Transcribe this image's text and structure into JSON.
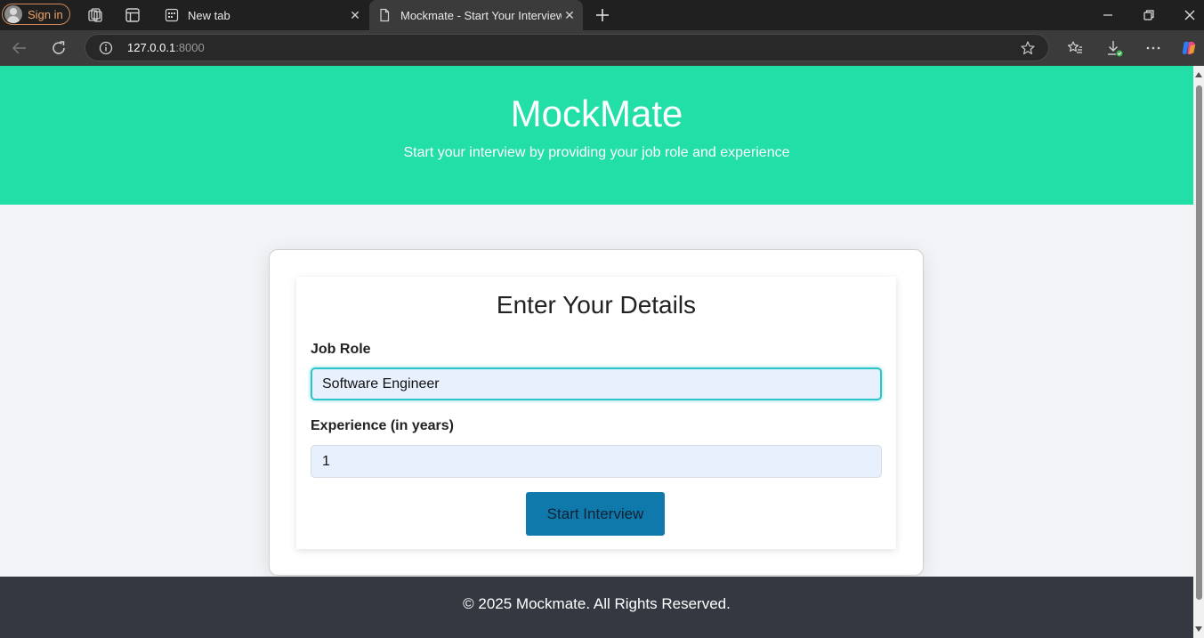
{
  "browser": {
    "signin_label": "Sign in",
    "tabs": [
      {
        "title": "New tab"
      },
      {
        "title": "Mockmate - Start Your Interview"
      }
    ],
    "url_host": "127.0.0.1",
    "url_port": ":8000"
  },
  "hero": {
    "title": "MockMate",
    "subtitle": "Start your interview by providing your job role and experience"
  },
  "form": {
    "heading": "Enter Your Details",
    "job_role_label": "Job Role",
    "job_role_value": "Software Engineer",
    "experience_label": "Experience (in years)",
    "experience_value": "1",
    "submit_label": "Start Interview"
  },
  "footer": {
    "text": "© 2025 Mockmate. All Rights Reserved."
  },
  "colors": {
    "hero_bg": "#22dea7",
    "button_bg": "#1079ac",
    "footer_bg": "#343840",
    "input_bg": "#e8f0fe"
  }
}
